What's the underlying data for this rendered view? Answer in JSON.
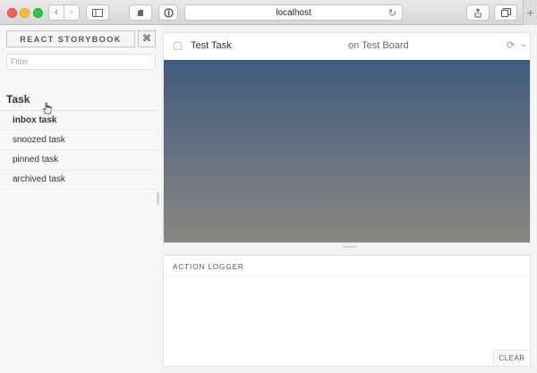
{
  "browser": {
    "url": "localhost",
    "new_tab_symbol": "+",
    "icons": [
      "back-icon",
      "forward-icon",
      "sidebar-icon",
      "extension-icon",
      "privacy-icon",
      "reload-icon",
      "share-icon",
      "tabs-icon"
    ]
  },
  "sidebar": {
    "brand": "REACT STORYBOOK",
    "shortcut_symbol": "⌘",
    "filter_placeholder": "Filter",
    "kind": "Task",
    "stories": [
      {
        "label": "inbox task",
        "active": true
      },
      {
        "label": "snoozed task",
        "active": false
      },
      {
        "label": "pinned task",
        "active": false
      },
      {
        "label": "archived task",
        "active": false
      }
    ]
  },
  "preview": {
    "task_title": "Test Task",
    "task_board": "on Test Board",
    "accent_color": "#58a5e0"
  },
  "logger": {
    "title": "ACTION LOGGER",
    "clear_label": "CLEAR"
  }
}
